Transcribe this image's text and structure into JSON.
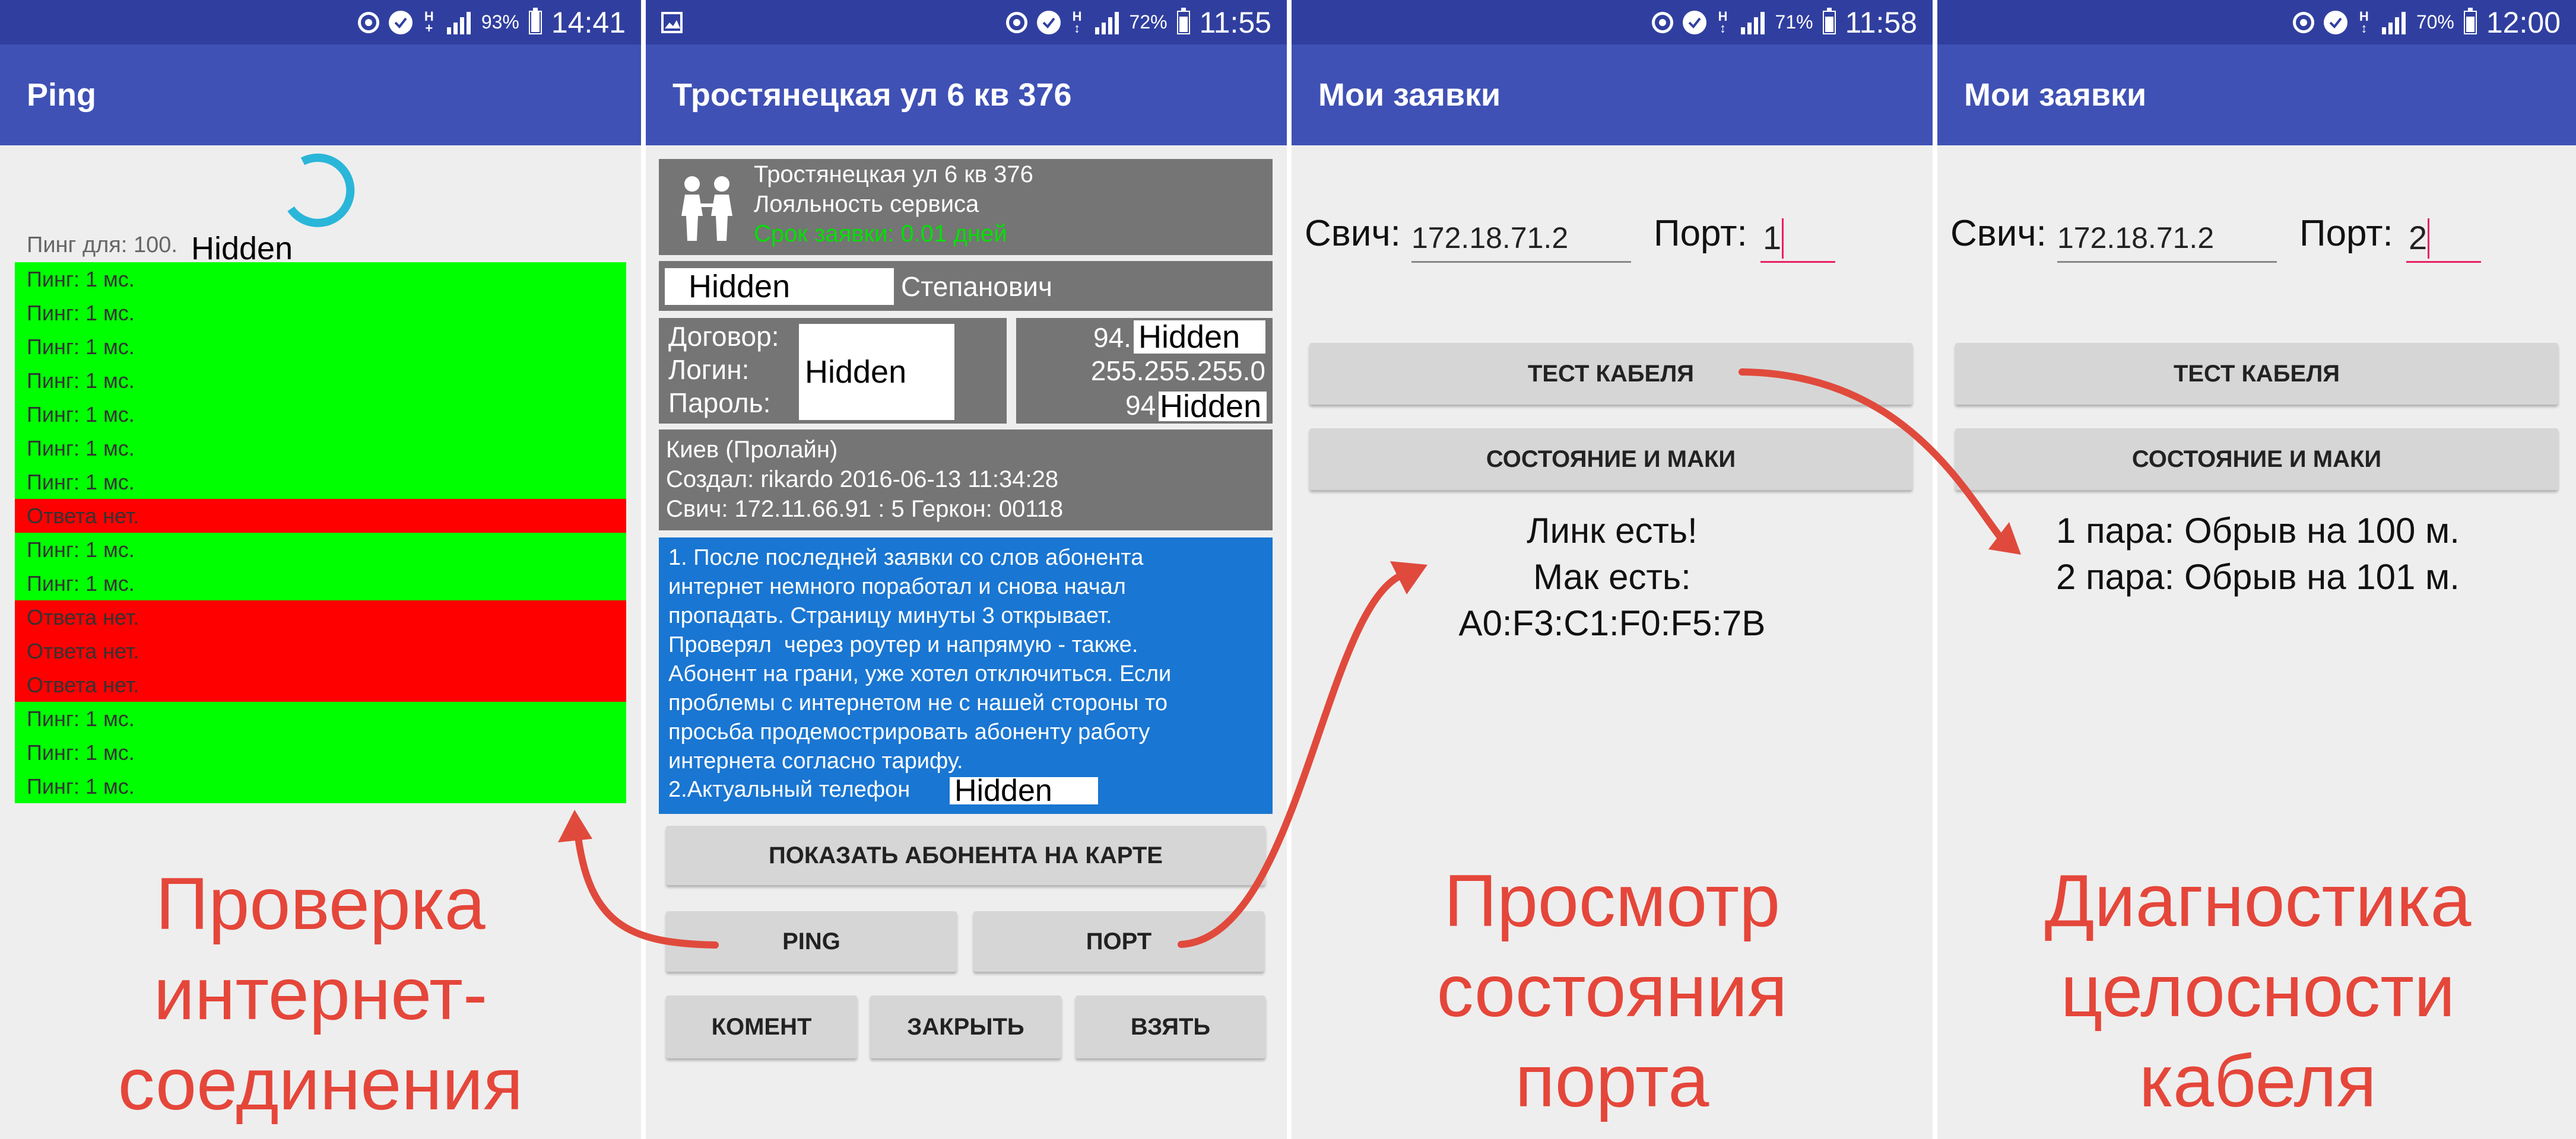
{
  "panels": [
    {
      "status": {
        "time": "14:41",
        "battery": "93%",
        "battery_level": 0.93
      },
      "title": "Ping",
      "ping_label": "Пинг для: 100.",
      "hidden": "Hidden",
      "rows": [
        {
          "text": "Пинг: 1 мс.",
          "ok": true
        },
        {
          "text": "Пинг: 1 мс.",
          "ok": true
        },
        {
          "text": "Пинг: 1 мс.",
          "ok": true
        },
        {
          "text": "Пинг: 1 мс.",
          "ok": true
        },
        {
          "text": "Пинг: 1 мс.",
          "ok": true
        },
        {
          "text": "Пинг: 1 мс.",
          "ok": true
        },
        {
          "text": "Пинг: 1 мс.",
          "ok": true
        },
        {
          "text": "Ответа нет.",
          "ok": false
        },
        {
          "text": "Пинг: 1 мс.",
          "ok": true
        },
        {
          "text": "Пинг: 1 мс.",
          "ok": true
        },
        {
          "text": "Ответа нет.",
          "ok": false
        },
        {
          "text": "Ответа нет.",
          "ok": false
        },
        {
          "text": "Ответа нет.",
          "ok": false
        },
        {
          "text": "Пинг: 1 мс.",
          "ok": true
        },
        {
          "text": "Пинг: 1 мс.",
          "ok": true
        },
        {
          "text": "Пинг: 1 мс.",
          "ok": true
        }
      ],
      "caption": [
        "Проверка",
        "интернет-",
        "соединения"
      ]
    },
    {
      "status": {
        "time": "11:55",
        "battery": "72%",
        "battery_level": 0.72
      },
      "title": "Тростянецкая ул 6 кв 376",
      "info": {
        "address": "Тростянецкая ул 6 кв 376",
        "loyalty": "Лояльность сервиса",
        "term": "Срок заявки: 0.01 дней"
      },
      "name": {
        "hidden": "Hidden",
        "patronymic": "Степанович"
      },
      "contract": {
        "contract_label": "Договор:",
        "login_label": "Логин:",
        "password_label": "Пароль:",
        "hidden": "Hidden",
        "ip_prefix": "94.",
        "mask": "255.255.255.0",
        "gw_prefix": "94"
      },
      "meta": {
        "city": "Киев (Пролайн)",
        "created": "Создал: rikardo 2016-06-13 11:34:28",
        "switch": "Свич: 172.11.66.91 : 5 Геркон: 00118"
      },
      "comment": {
        "lines": [
          "1. После последней заявки со слов абонента",
          "интернет немного поработал и снова начал",
          "пропадать. Страницу минуты 3 открывает.",
          "Проверял  через роутер и напрямую - также.",
          "Абонент на грани, уже хотел отключиться. Если",
          "проблемы с интернетом не с нашей стороны то",
          "просьба продемострировать абоненту работу",
          "интернета согласно тарифу."
        ],
        "phone_label": "2.Актуальный телефон",
        "hidden": "Hidden"
      },
      "buttons": {
        "map": "Показать абонента на карте",
        "ping": "Ping",
        "port": "Порт",
        "comment": "Комент",
        "close": "Закрыть",
        "take": "Взять"
      }
    },
    {
      "status": {
        "time": "11:58",
        "battery": "71%",
        "battery_level": 0.71
      },
      "title": "Мои заявки",
      "switch_label": "Свич:",
      "switch_value": "172.18.71.2",
      "port_label": "Порт:",
      "port_value": "1",
      "buttons": {
        "cable_test": "Тест кабеля",
        "state": "Состояние и маки"
      },
      "result": [
        "Линк есть!",
        "Мак есть:",
        "A0:F3:C1:F0:F5:7B"
      ],
      "caption": [
        "Просмотр",
        "состояния",
        "порта"
      ]
    },
    {
      "status": {
        "time": "12:00",
        "battery": "70%",
        "battery_level": 0.7
      },
      "title": "Мои заявки",
      "switch_label": "Свич:",
      "switch_value": "172.18.71.2",
      "port_label": "Порт:",
      "port_value": "2",
      "buttons": {
        "cable_test": "Тест кабеля",
        "state": "Состояние и маки"
      },
      "result": [
        "1 пара: Обрыв на 100 м.",
        "2 пара: Обрыв на 101 м."
      ],
      "caption": [
        "Диагностика",
        "целосности",
        "кабеля"
      ]
    }
  ],
  "colors": {
    "statusbar": "#303f9f",
    "appbar": "#3f51b5",
    "ping_ok": "#00ff00",
    "ping_fail": "#ff0000",
    "info_box": "#757575",
    "comment_box": "#1976d2",
    "caption": "#e5463a",
    "arrow": "#e04a3c",
    "term_text": "#00e000",
    "input_active": "#e91e63"
  }
}
